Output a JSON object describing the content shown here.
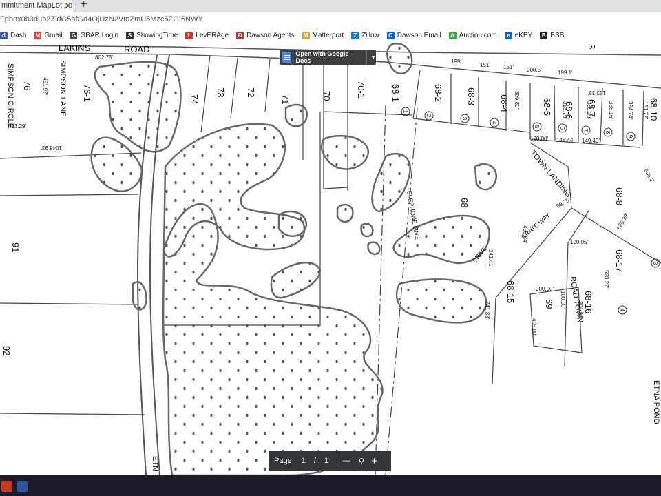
{
  "tab": {
    "title": "mmitment MapLot.pdf",
    "close": "×",
    "new_tab": "+"
  },
  "address": {
    "url": "Fpbnx0b3dub2ZldG5hfGd4OjUzN2VmZmU5Mzc5ZGI5NWY"
  },
  "bookmarks": [
    {
      "label": "Dash",
      "icon": "d",
      "color": "#3b5998"
    },
    {
      "label": "Gmail",
      "icon": "M",
      "color": "#ea4335"
    },
    {
      "label": "GBAR Login",
      "icon": "G",
      "color": "#444444"
    },
    {
      "label": "ShowingTime",
      "icon": "S",
      "color": "#2b2b4b"
    },
    {
      "label": "LevERAge",
      "icon": "L",
      "color": "#c0392b"
    },
    {
      "label": "Dawson Agents",
      "icon": "D",
      "color": "#b03a2e"
    },
    {
      "label": "Matterport",
      "icon": "M",
      "color": "#e0a030"
    },
    {
      "label": "Zillow",
      "icon": "Z",
      "color": "#1277e1"
    },
    {
      "label": "Dawson Email",
      "icon": "O",
      "color": "#0a64c8"
    },
    {
      "label": "Auction.com",
      "icon": "A",
      "color": "#3aa641"
    },
    {
      "label": "eKEY",
      "icon": "e",
      "color": "#1565c0"
    },
    {
      "label": "BSB",
      "icon": "B",
      "color": "#222222"
    }
  ],
  "viewer": {
    "open_with": "Open with Google Docs",
    "page_label": "Page",
    "page_current": "1",
    "page_sep": "/",
    "page_total": "1",
    "zoom_out": "—",
    "zoom_in": "+"
  },
  "map": {
    "road_lakins": "LAKINS",
    "road_road": "ROAD",
    "simpson_circle": "SIMPSON CIRCLE",
    "simpson_lane": "SIMPSON LANE",
    "telephone_line": "TELEPHONE LINE",
    "town_landing": "TOWN LANDING",
    "crate_way": "CRATE WAY",
    "drive": "DRIVE",
    "road_town": "ROAD TOWN",
    "etna_pond": "ETNA POND",
    "etn": "ETN",
    "lots": [
      "76",
      "76-1",
      "74",
      "73",
      "72",
      "71",
      "70",
      "70-1",
      "68-1",
      "68-2",
      "68-3",
      "68-4",
      "68-5",
      "68-6",
      "68-7",
      "68-8",
      "68-10",
      "68",
      "68-15",
      "68-16",
      "68-17",
      "69",
      "91",
      "92",
      "3"
    ],
    "dims": [
      "802.75'",
      "451.97'",
      "423.29'",
      "1048.93'",
      "199'",
      "151'",
      "151'",
      "200.5'",
      "199.1'",
      "309.80'",
      "313.79'",
      "330.29'",
      "338.16'",
      "324.74'",
      "151.72'",
      "153.33'",
      "120.00'",
      "148.44'",
      "149.40'",
      "99.75'",
      "456.84'",
      "241.41'",
      "120.05'",
      "626.39'",
      "520.27'",
      "200.00'",
      "100.00'",
      "301.00'",
      "405.00'",
      "741.33'",
      "606.3'"
    ],
    "circles": [
      "1",
      "2",
      "3",
      "4",
      "5",
      "6",
      "7",
      "8",
      "9",
      "3",
      "4"
    ]
  }
}
